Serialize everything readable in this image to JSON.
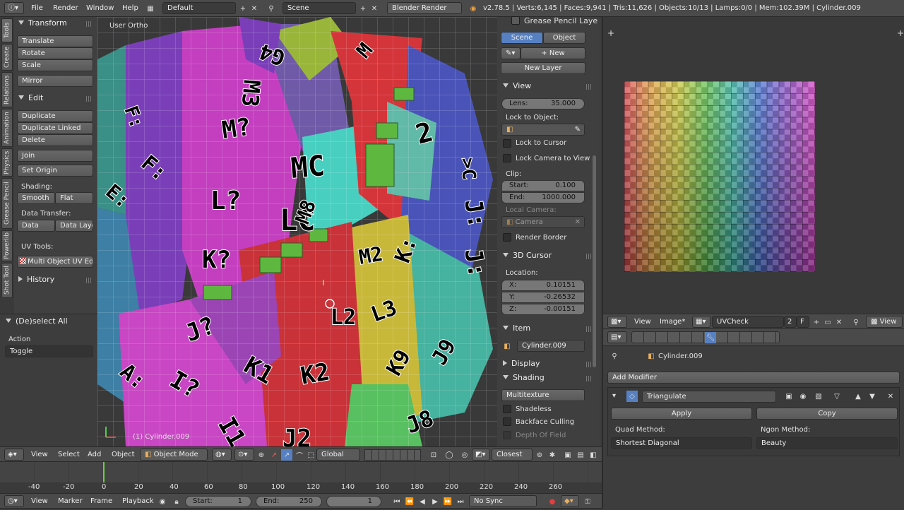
{
  "colors": {
    "bg": "#3d3d3d",
    "header": "#4a4a4a",
    "accent": "#5680c2",
    "timeline_playhead": "#6ad040"
  },
  "top": {
    "menus": [
      "File",
      "Render",
      "Window",
      "Help"
    ],
    "layout": "Default",
    "scene": "Scene",
    "engine": "Blender Render",
    "stats": "v2.78.5 | Verts:6,145 | Faces:9,941 | Tris:11,626 | Objects:10/13 | Lamps:0/0 | Mem:102.39M | Cylinder.009"
  },
  "tabs": [
    "Tools",
    "Create",
    "Relations",
    "Animation",
    "Physics",
    "Grease Pencil",
    "Powerlib",
    "Shot Tool"
  ],
  "tools": {
    "transform": "Transform",
    "translate": "Translate",
    "rotate": "Rotate",
    "scale": "Scale",
    "mirror": "Mirror",
    "edit": "Edit",
    "duplicate": "Duplicate",
    "duplicate_linked": "Duplicate Linked",
    "delete": "Delete",
    "join": "Join",
    "set_origin": "Set Origin",
    "shading": "Shading:",
    "smooth": "Smooth",
    "flat": "Flat",
    "data_transfer": "Data Transfer:",
    "data": "Data",
    "data_layout": "Data Layo",
    "uv_tools": "UV Tools:",
    "multi_uv": "Multi Object UV Edi...",
    "history": "History",
    "deselect_all": "(De)select All",
    "action": "Action",
    "toggle": "Toggle"
  },
  "viewport": {
    "view_label": "User Ortho",
    "object_label": "(1) Cylinder.009"
  },
  "props": {
    "grease_pencil": "Grease Pencil Laye",
    "scene": "Scene",
    "object": "Object",
    "new": "New",
    "new_layer": "New Layer",
    "view": "View",
    "lens_label": "Lens:",
    "lens_value": "35.000",
    "lock_object": "Lock to Object:",
    "lock_cursor": "Lock to Cursor",
    "lock_camera": "Lock Camera to View",
    "clip": "Clip:",
    "start_label": "Start:",
    "start_value": "0.100",
    "end_label": "End:",
    "end_value": "1000.000",
    "local_camera": "Local Camera:",
    "camera": "Camera",
    "render_border": "Render Border",
    "cursor": "3D Cursor",
    "location": "Location:",
    "x_label": "X:",
    "x_value": "0.10151",
    "y_label": "Y:",
    "y_value": "-0.26532",
    "z_label": "Z:",
    "z_value": "-0.00151",
    "item": "Item",
    "item_name": "Cylinder.009",
    "display": "Display",
    "shading": "Shading",
    "multitexture": "Multitexture",
    "shadeless": "Shadeless",
    "backface": "Backface Culling",
    "depth": "Depth Of Field"
  },
  "viewport_header": {
    "menus": [
      "View",
      "Select",
      "Add",
      "Object"
    ],
    "mode": "Object Mode",
    "orientation": "Global",
    "snap": "Closest"
  },
  "timeline": {
    "ticks": [
      "-40",
      "-20",
      "0",
      "20",
      "40",
      "60",
      "80",
      "100",
      "120",
      "140",
      "160",
      "180",
      "200",
      "220",
      "240",
      "260"
    ],
    "menus": [
      "View",
      "Marker",
      "Frame",
      "Playback"
    ],
    "start_label": "Start:",
    "start": "1",
    "end_label": "End:",
    "end": "250",
    "current": "1",
    "sync": "No Sync"
  },
  "image_editor": {
    "menus": [
      "View",
      "Image*"
    ],
    "image": "UVCheck",
    "users": "2",
    "fake": "F",
    "view": "View"
  },
  "modifiers": {
    "object": "Cylinder.009",
    "add": "Add Modifier",
    "name": "Triangulate",
    "apply": "Apply",
    "copy": "Copy",
    "quad_label": "Quad Method:",
    "quad": "Shortest Diagonal",
    "ngon_label": "Ngon Method:",
    "ngon": "Beauty"
  }
}
